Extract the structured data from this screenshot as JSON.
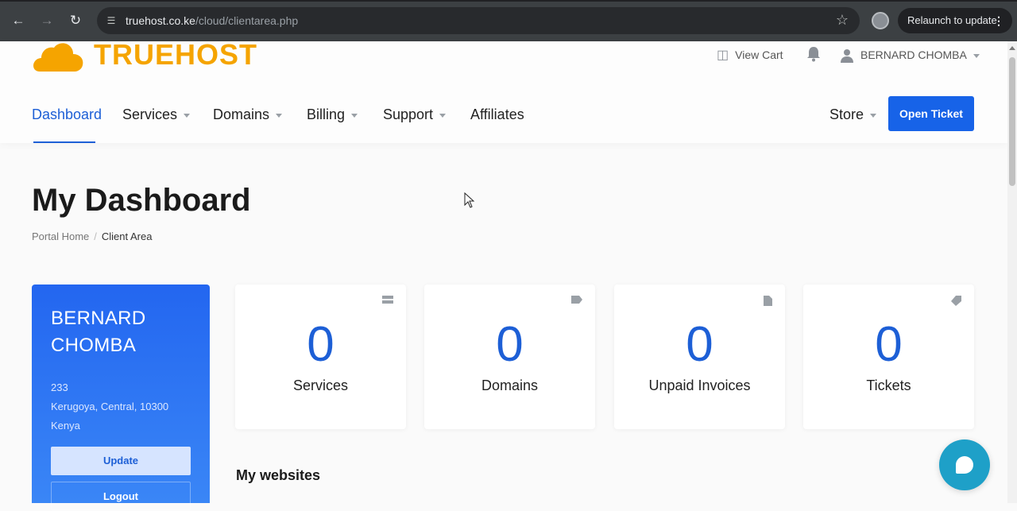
{
  "browser": {
    "url_host": "truehost.co.ke",
    "url_path": "/cloud/clientarea.php",
    "relaunch_label": "Relaunch to update"
  },
  "header": {
    "logo_text": "TRUEHOST",
    "view_cart": "View Cart",
    "user_name": "BERNARD CHOMBA",
    "nav": [
      {
        "label": "Dashboard"
      },
      {
        "label": "Services"
      },
      {
        "label": "Domains"
      },
      {
        "label": "Billing"
      },
      {
        "label": "Support"
      },
      {
        "label": "Affiliates"
      }
    ],
    "store": "Store",
    "open_ticket": "Open Ticket"
  },
  "page": {
    "title": "My Dashboard",
    "breadcrumb": [
      "Portal Home",
      "Client Area"
    ]
  },
  "profile": {
    "name": "BERNARD CHOMBA",
    "address_line1": "233",
    "address_line2": "Kerugoya, Central, 10300",
    "address_line3": "Kenya",
    "update_label": "Update",
    "logout_label": "Logout"
  },
  "stats": [
    {
      "value": "0",
      "label": "Services",
      "icon": "server-icon"
    },
    {
      "value": "0",
      "label": "Domains",
      "icon": "tag-icon"
    },
    {
      "value": "0",
      "label": "Unpaid Invoices",
      "icon": "file-icon"
    },
    {
      "value": "0",
      "label": "Tickets",
      "icon": "ticket-icon"
    }
  ],
  "sections": {
    "websites_title": "My websites"
  },
  "colors": {
    "accent": "#1d5fd6",
    "brand": "#f5a400",
    "chat": "#1ea0c8"
  }
}
